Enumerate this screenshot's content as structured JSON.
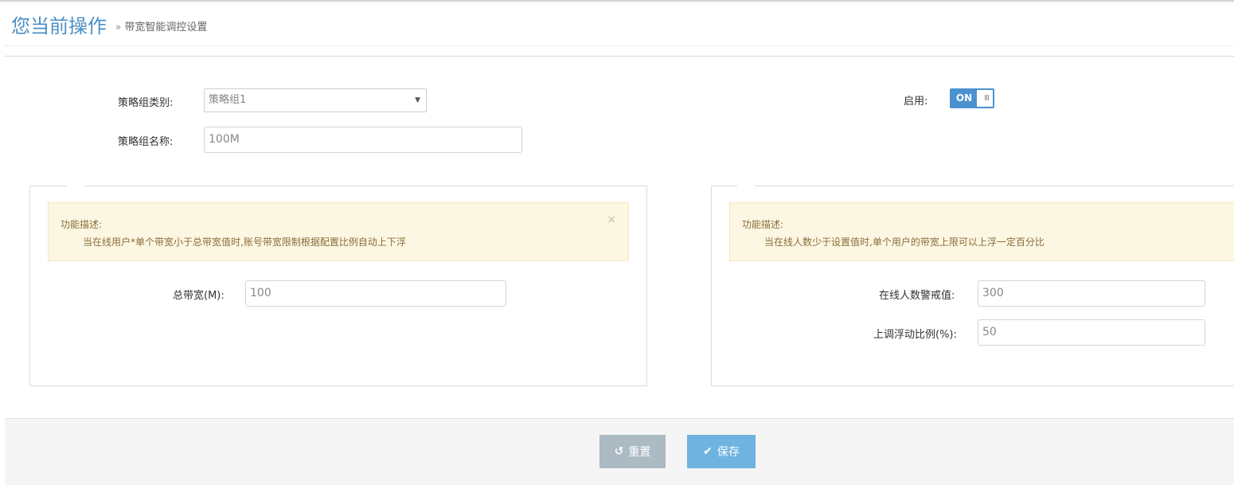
{
  "header": {
    "title": "您当前操作",
    "breadcrumb_sep": "»",
    "breadcrumb": "带宽智能调控设置"
  },
  "form": {
    "group_type_label": "策略组类别:",
    "group_type_value": "策略组1",
    "group_name_label": "策略组名称:",
    "group_name_value": "100M",
    "enable_label": "启用:",
    "enable_toggle": {
      "on_label": "ON",
      "grip": "III",
      "state": true
    }
  },
  "panel_left": {
    "alert_title": "功能描述:",
    "alert_desc": "当在线用户*单个带宽小于总带宽值时,账号带宽限制根据配置比例自动上下浮",
    "alert_close": "×",
    "total_bw_label": "总带宽(M):",
    "total_bw_value": "100"
  },
  "panel_right": {
    "alert_title": "功能描述:",
    "alert_desc": "当在线人数少于设置值时,单个用户的带宽上限可以上浮一定百分比",
    "online_warn_label": "在线人数警戒值:",
    "online_warn_value": "300",
    "float_ratio_label": "上调浮动比例(%):",
    "float_ratio_value": "50"
  },
  "footer": {
    "reset_label": "重置",
    "save_label": "保存"
  },
  "colors": {
    "title": "#4b8fc4",
    "toggle": "#4a91d0",
    "alert_bg": "#fcf7e2",
    "reset_btn": "#abbac3",
    "save_btn": "#6fb3e0"
  },
  "icons": {
    "reset": "undo-icon",
    "save": "check-icon",
    "caret": "caret-down-icon",
    "close": "close-icon"
  }
}
